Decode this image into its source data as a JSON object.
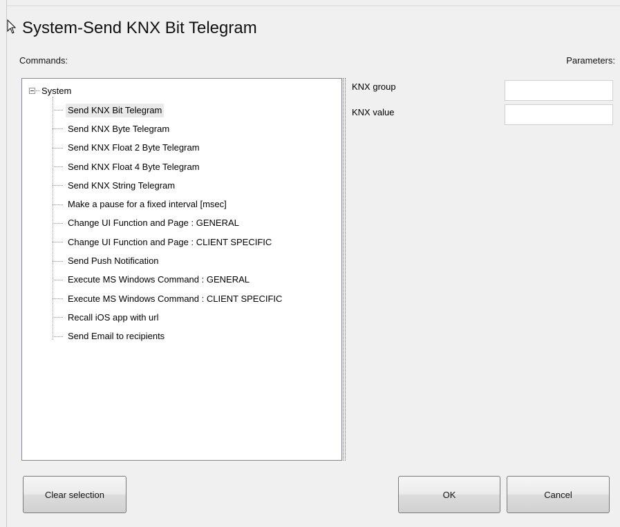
{
  "dialog": {
    "title": "System-Send KNX Bit Telegram",
    "commands_label": "Commands:",
    "parameters_label": "Parameters:"
  },
  "tree": {
    "root": "System",
    "items": [
      "Send KNX Bit Telegram",
      "Send KNX Byte Telegram",
      "Send KNX Float 2 Byte Telegram",
      "Send KNX Float 4 Byte Telegram",
      "Send KNX String Telegram",
      "Make a pause for a fixed interval [msec]",
      "Change UI Function and Page : GENERAL",
      "Change UI Function and Page : CLIENT SPECIFIC",
      "Send Push Notification",
      "Execute MS Windows Command : GENERAL",
      "Execute MS Windows Command : CLIENT SPECIFIC",
      "Recall iOS app with url",
      "Send Email to recipients"
    ],
    "selected_item": "Send KNX Bit Telegram"
  },
  "parameters": [
    {
      "label": "KNX group",
      "value": ""
    },
    {
      "label": "KNX value",
      "value": ""
    }
  ],
  "buttons": {
    "clear": "Clear  selection",
    "ok": "OK",
    "cancel": "Cancel"
  },
  "icons": {
    "cursor": "arrow-cursor-icon",
    "expander": "collapse-minus-icon"
  }
}
